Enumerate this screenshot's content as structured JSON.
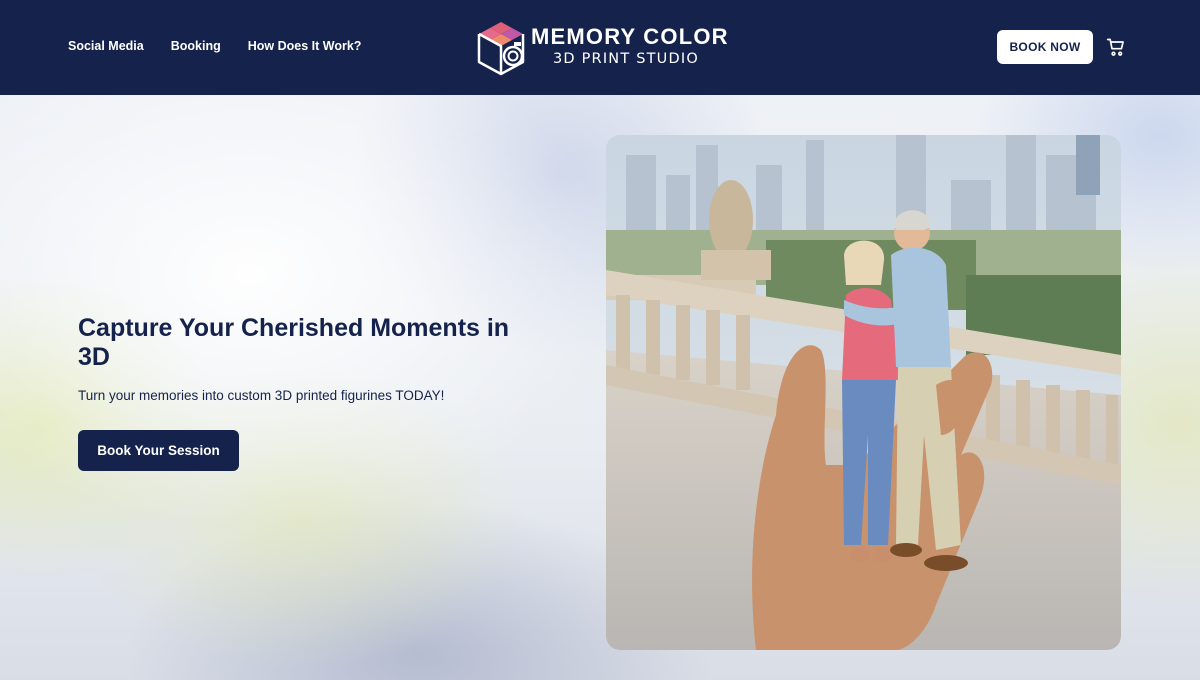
{
  "nav": {
    "items": [
      {
        "label": "Social Media"
      },
      {
        "label": "Booking"
      },
      {
        "label": "How Does It Work?"
      }
    ]
  },
  "logo": {
    "title": "MEMORY COLOR",
    "subtitle": "3D PRINT STUDIO"
  },
  "header": {
    "book_now_label": "BOOK NOW",
    "cart_icon": "cart-icon"
  },
  "hero": {
    "headline": "Capture Your Cherished Moments in 3D",
    "subtext": "Turn your memories into custom 3D printed figurines TODAY!",
    "cta_label": "Book Your Session",
    "image_alt": "hand-holding-3d-printed-couple-figurine"
  },
  "colors": {
    "brand_navy": "#15224b",
    "white": "#ffffff"
  }
}
